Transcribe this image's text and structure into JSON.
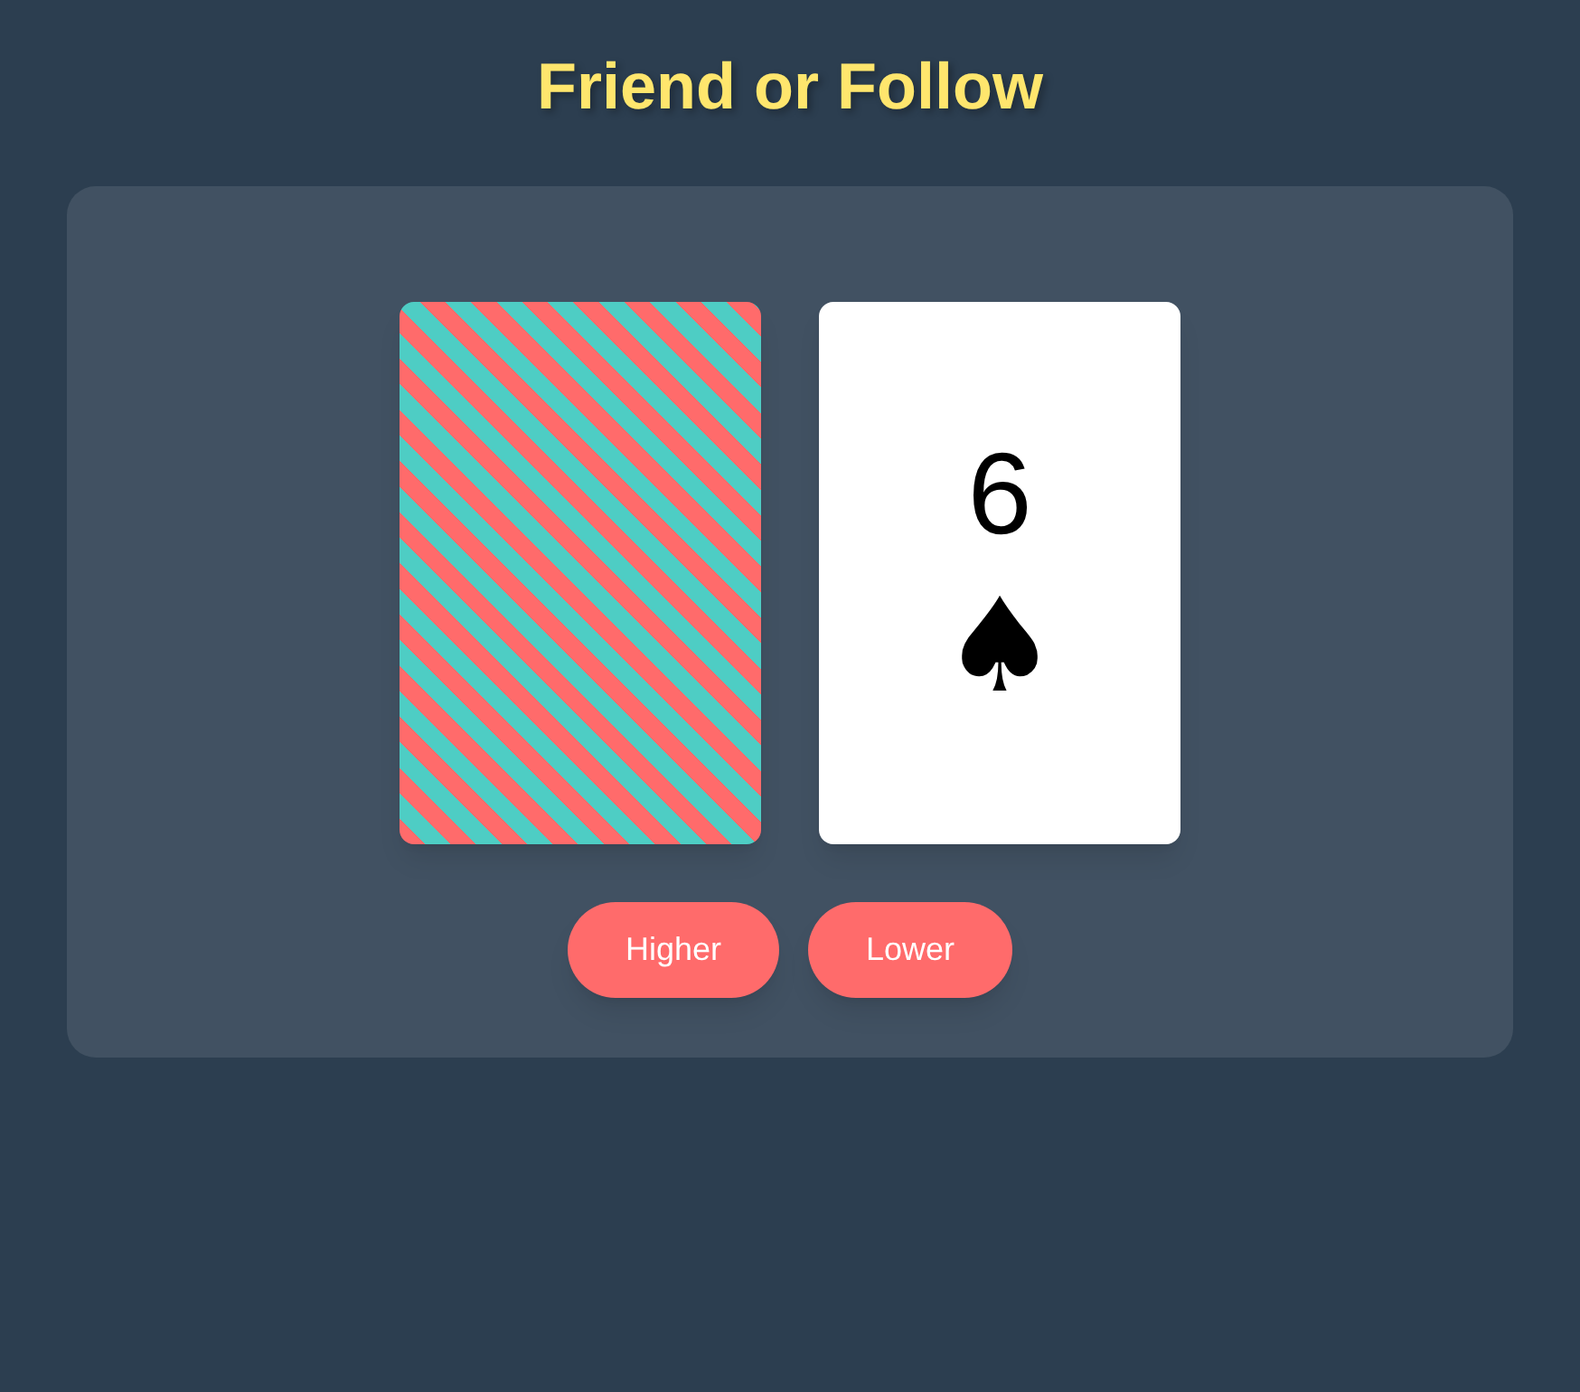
{
  "title": "Friend or Follow",
  "cards": [
    {
      "kind": "back"
    },
    {
      "kind": "face",
      "rank": "6",
      "suit": "♠"
    }
  ],
  "buttons": [
    "Higher",
    "Lower"
  ]
}
